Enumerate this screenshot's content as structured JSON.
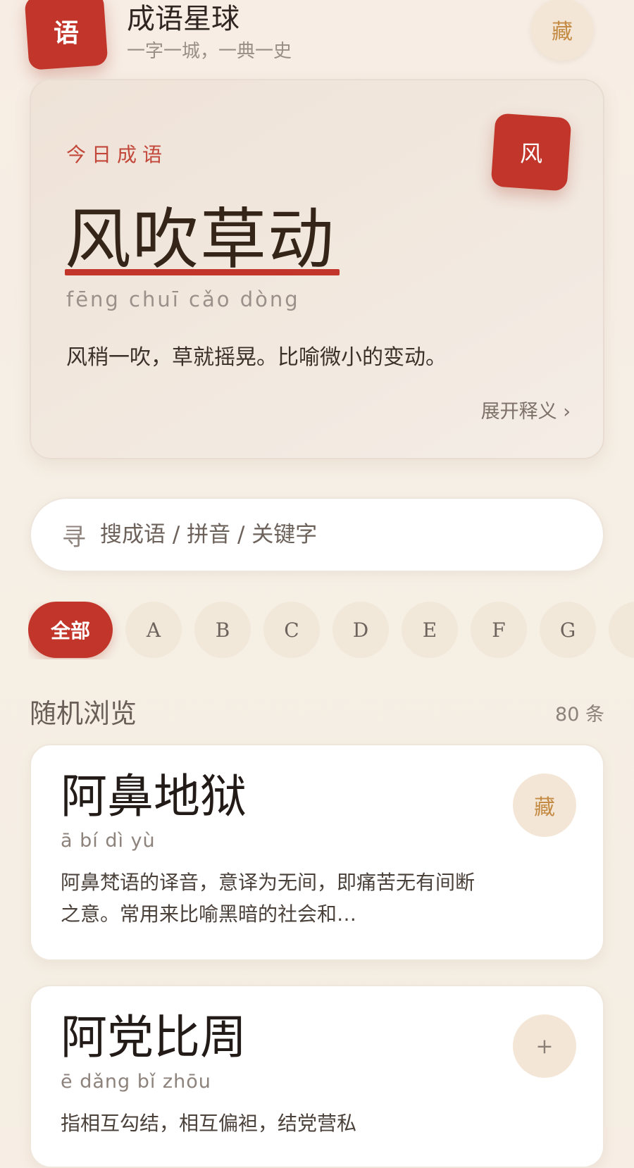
{
  "header": {
    "logo_char": "语",
    "title": "成语星球",
    "subtitle": "一字一城，一典一史",
    "collect_label": "藏"
  },
  "daily": {
    "label": "今日成语",
    "seal_char": "风",
    "idiom": "风吹草动",
    "pinyin": "fēng chuī cǎo dòng",
    "meaning": "风稍一吹，草就摇晃。比喻微小的变动。",
    "expand_label": "展开释义 ›"
  },
  "search": {
    "icon_char": "寻",
    "placeholder": "搜成语 / 拼音 / 关键字",
    "value": ""
  },
  "filters": {
    "all_label": "全部",
    "letters": [
      "A",
      "B",
      "C",
      "D",
      "E",
      "F",
      "G"
    ]
  },
  "section": {
    "title": "随机浏览",
    "count": "80 条"
  },
  "idioms": [
    {
      "name": "阿鼻地狱",
      "pinyin": "ā bí dì yù",
      "desc": "阿鼻梵语的译音，意译为无间，即痛苦无有间断之意。常用来比喻黑暗的社会和…",
      "action": "藏"
    },
    {
      "name": "阿党比周",
      "pinyin": "ē dǎng bǐ zhōu",
      "desc": "指相互勾结，相互偏袒，结党营私",
      "action": "+"
    }
  ],
  "colors": {
    "accent_red": "#c2352a",
    "gold": "#c48b44",
    "background": "#f6efe5"
  }
}
